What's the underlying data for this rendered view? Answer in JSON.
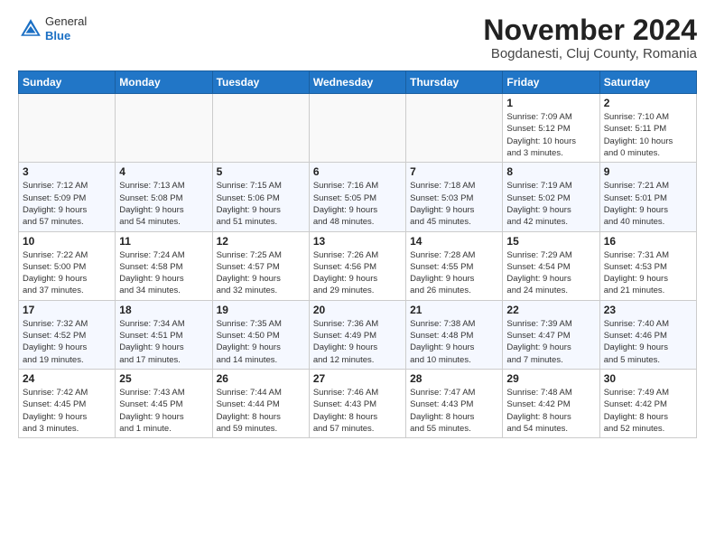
{
  "header": {
    "logo_line1": "General",
    "logo_line2": "Blue",
    "title": "November 2024",
    "subtitle": "Bogdanesti, Cluj County, Romania"
  },
  "calendar": {
    "headers": [
      "Sunday",
      "Monday",
      "Tuesday",
      "Wednesday",
      "Thursday",
      "Friday",
      "Saturday"
    ],
    "weeks": [
      [
        {
          "day": "",
          "info": ""
        },
        {
          "day": "",
          "info": ""
        },
        {
          "day": "",
          "info": ""
        },
        {
          "day": "",
          "info": ""
        },
        {
          "day": "",
          "info": ""
        },
        {
          "day": "1",
          "info": "Sunrise: 7:09 AM\nSunset: 5:12 PM\nDaylight: 10 hours\nand 3 minutes."
        },
        {
          "day": "2",
          "info": "Sunrise: 7:10 AM\nSunset: 5:11 PM\nDaylight: 10 hours\nand 0 minutes."
        }
      ],
      [
        {
          "day": "3",
          "info": "Sunrise: 7:12 AM\nSunset: 5:09 PM\nDaylight: 9 hours\nand 57 minutes."
        },
        {
          "day": "4",
          "info": "Sunrise: 7:13 AM\nSunset: 5:08 PM\nDaylight: 9 hours\nand 54 minutes."
        },
        {
          "day": "5",
          "info": "Sunrise: 7:15 AM\nSunset: 5:06 PM\nDaylight: 9 hours\nand 51 minutes."
        },
        {
          "day": "6",
          "info": "Sunrise: 7:16 AM\nSunset: 5:05 PM\nDaylight: 9 hours\nand 48 minutes."
        },
        {
          "day": "7",
          "info": "Sunrise: 7:18 AM\nSunset: 5:03 PM\nDaylight: 9 hours\nand 45 minutes."
        },
        {
          "day": "8",
          "info": "Sunrise: 7:19 AM\nSunset: 5:02 PM\nDaylight: 9 hours\nand 42 minutes."
        },
        {
          "day": "9",
          "info": "Sunrise: 7:21 AM\nSunset: 5:01 PM\nDaylight: 9 hours\nand 40 minutes."
        }
      ],
      [
        {
          "day": "10",
          "info": "Sunrise: 7:22 AM\nSunset: 5:00 PM\nDaylight: 9 hours\nand 37 minutes."
        },
        {
          "day": "11",
          "info": "Sunrise: 7:24 AM\nSunset: 4:58 PM\nDaylight: 9 hours\nand 34 minutes."
        },
        {
          "day": "12",
          "info": "Sunrise: 7:25 AM\nSunset: 4:57 PM\nDaylight: 9 hours\nand 32 minutes."
        },
        {
          "day": "13",
          "info": "Sunrise: 7:26 AM\nSunset: 4:56 PM\nDaylight: 9 hours\nand 29 minutes."
        },
        {
          "day": "14",
          "info": "Sunrise: 7:28 AM\nSunset: 4:55 PM\nDaylight: 9 hours\nand 26 minutes."
        },
        {
          "day": "15",
          "info": "Sunrise: 7:29 AM\nSunset: 4:54 PM\nDaylight: 9 hours\nand 24 minutes."
        },
        {
          "day": "16",
          "info": "Sunrise: 7:31 AM\nSunset: 4:53 PM\nDaylight: 9 hours\nand 21 minutes."
        }
      ],
      [
        {
          "day": "17",
          "info": "Sunrise: 7:32 AM\nSunset: 4:52 PM\nDaylight: 9 hours\nand 19 minutes."
        },
        {
          "day": "18",
          "info": "Sunrise: 7:34 AM\nSunset: 4:51 PM\nDaylight: 9 hours\nand 17 minutes."
        },
        {
          "day": "19",
          "info": "Sunrise: 7:35 AM\nSunset: 4:50 PM\nDaylight: 9 hours\nand 14 minutes."
        },
        {
          "day": "20",
          "info": "Sunrise: 7:36 AM\nSunset: 4:49 PM\nDaylight: 9 hours\nand 12 minutes."
        },
        {
          "day": "21",
          "info": "Sunrise: 7:38 AM\nSunset: 4:48 PM\nDaylight: 9 hours\nand 10 minutes."
        },
        {
          "day": "22",
          "info": "Sunrise: 7:39 AM\nSunset: 4:47 PM\nDaylight: 9 hours\nand 7 minutes."
        },
        {
          "day": "23",
          "info": "Sunrise: 7:40 AM\nSunset: 4:46 PM\nDaylight: 9 hours\nand 5 minutes."
        }
      ],
      [
        {
          "day": "24",
          "info": "Sunrise: 7:42 AM\nSunset: 4:45 PM\nDaylight: 9 hours\nand 3 minutes."
        },
        {
          "day": "25",
          "info": "Sunrise: 7:43 AM\nSunset: 4:45 PM\nDaylight: 9 hours\nand 1 minute."
        },
        {
          "day": "26",
          "info": "Sunrise: 7:44 AM\nSunset: 4:44 PM\nDaylight: 8 hours\nand 59 minutes."
        },
        {
          "day": "27",
          "info": "Sunrise: 7:46 AM\nSunset: 4:43 PM\nDaylight: 8 hours\nand 57 minutes."
        },
        {
          "day": "28",
          "info": "Sunrise: 7:47 AM\nSunset: 4:43 PM\nDaylight: 8 hours\nand 55 minutes."
        },
        {
          "day": "29",
          "info": "Sunrise: 7:48 AM\nSunset: 4:42 PM\nDaylight: 8 hours\nand 54 minutes."
        },
        {
          "day": "30",
          "info": "Sunrise: 7:49 AM\nSunset: 4:42 PM\nDaylight: 8 hours\nand 52 minutes."
        }
      ]
    ]
  }
}
